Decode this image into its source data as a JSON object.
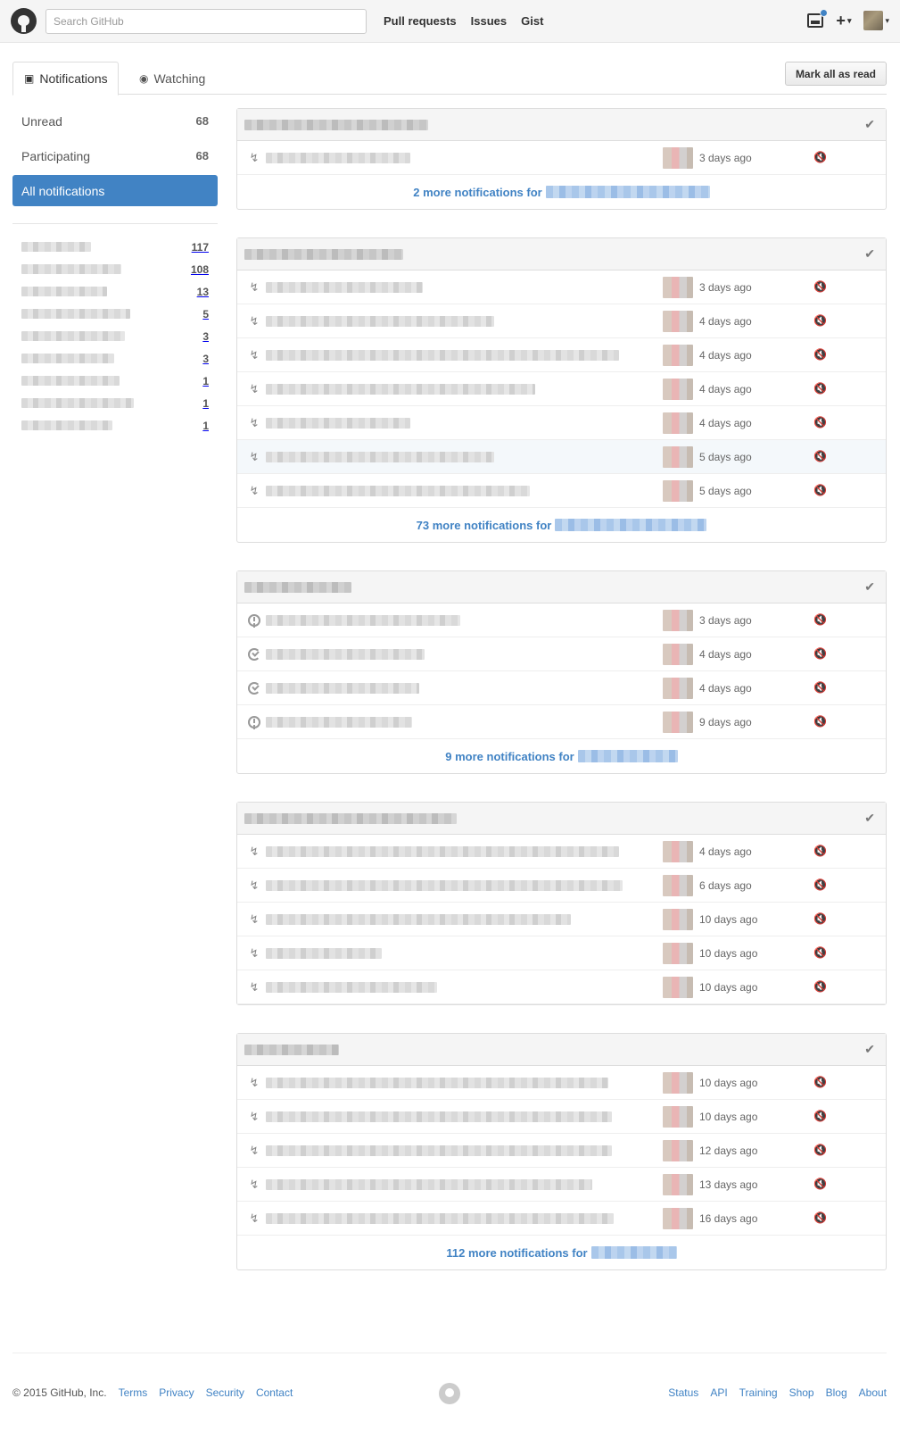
{
  "header": {
    "search_placeholder": "Search GitHub",
    "nav": [
      "Pull requests",
      "Issues",
      "Gist"
    ],
    "plus_label": "+",
    "caret": "▾"
  },
  "tabs": {
    "notifications": "Notifications",
    "watching": "Watching"
  },
  "mark_all_label": "Mark all as read",
  "filters": [
    {
      "label": "Unread",
      "count": "68"
    },
    {
      "label": "Participating",
      "count": "68"
    },
    {
      "label": "All notifications",
      "count": ""
    }
  ],
  "repo_counts": [
    "117",
    "108",
    "13",
    "5",
    "3",
    "3",
    "1",
    "1",
    "1"
  ],
  "groups": [
    {
      "rows": [
        {
          "type": "pr",
          "time": "3 days ago"
        }
      ],
      "more": "2 more notifications for"
    },
    {
      "rows": [
        {
          "type": "pr",
          "time": "3 days ago"
        },
        {
          "type": "pr",
          "time": "4 days ago"
        },
        {
          "type": "pr",
          "time": "4 days ago"
        },
        {
          "type": "pr",
          "time": "4 days ago"
        },
        {
          "type": "pr",
          "time": "4 days ago"
        },
        {
          "type": "pr",
          "time": "5 days ago"
        },
        {
          "type": "pr",
          "time": "5 days ago"
        }
      ],
      "more": "73 more notifications for"
    },
    {
      "rows": [
        {
          "type": "issue",
          "time": "3 days ago"
        },
        {
          "type": "issue-closed",
          "time": "4 days ago"
        },
        {
          "type": "issue-closed",
          "time": "4 days ago"
        },
        {
          "type": "issue",
          "time": "9 days ago"
        }
      ],
      "more": "9 more notifications for"
    },
    {
      "rows": [
        {
          "type": "pr",
          "time": "4 days ago"
        },
        {
          "type": "pr",
          "time": "6 days ago"
        },
        {
          "type": "pr",
          "time": "10 days ago"
        },
        {
          "type": "pr",
          "time": "10 days ago"
        },
        {
          "type": "pr",
          "time": "10 days ago"
        }
      ],
      "more": ""
    },
    {
      "rows": [
        {
          "type": "pr",
          "time": "10 days ago"
        },
        {
          "type": "pr",
          "time": "10 days ago"
        },
        {
          "type": "pr",
          "time": "12 days ago"
        },
        {
          "type": "pr",
          "time": "13 days ago"
        },
        {
          "type": "pr",
          "time": "16 days ago"
        }
      ],
      "more": "112 more notifications for"
    }
  ],
  "footer": {
    "copyright": "© 2015 GitHub, Inc.",
    "left_links": [
      "Terms",
      "Privacy",
      "Security",
      "Contact"
    ],
    "right_links": [
      "Status",
      "API",
      "Training",
      "Shop",
      "Blog",
      "About"
    ]
  },
  "icons": {
    "check": "check-icon",
    "mute": "mute-icon",
    "pull_request": "pull-request-icon",
    "issue_opened": "issue-opened-icon",
    "issue_reopened": "issue-reopened-icon"
  },
  "colors": {
    "accent": "#4183c4",
    "header_bg": "#f5f5f5"
  }
}
